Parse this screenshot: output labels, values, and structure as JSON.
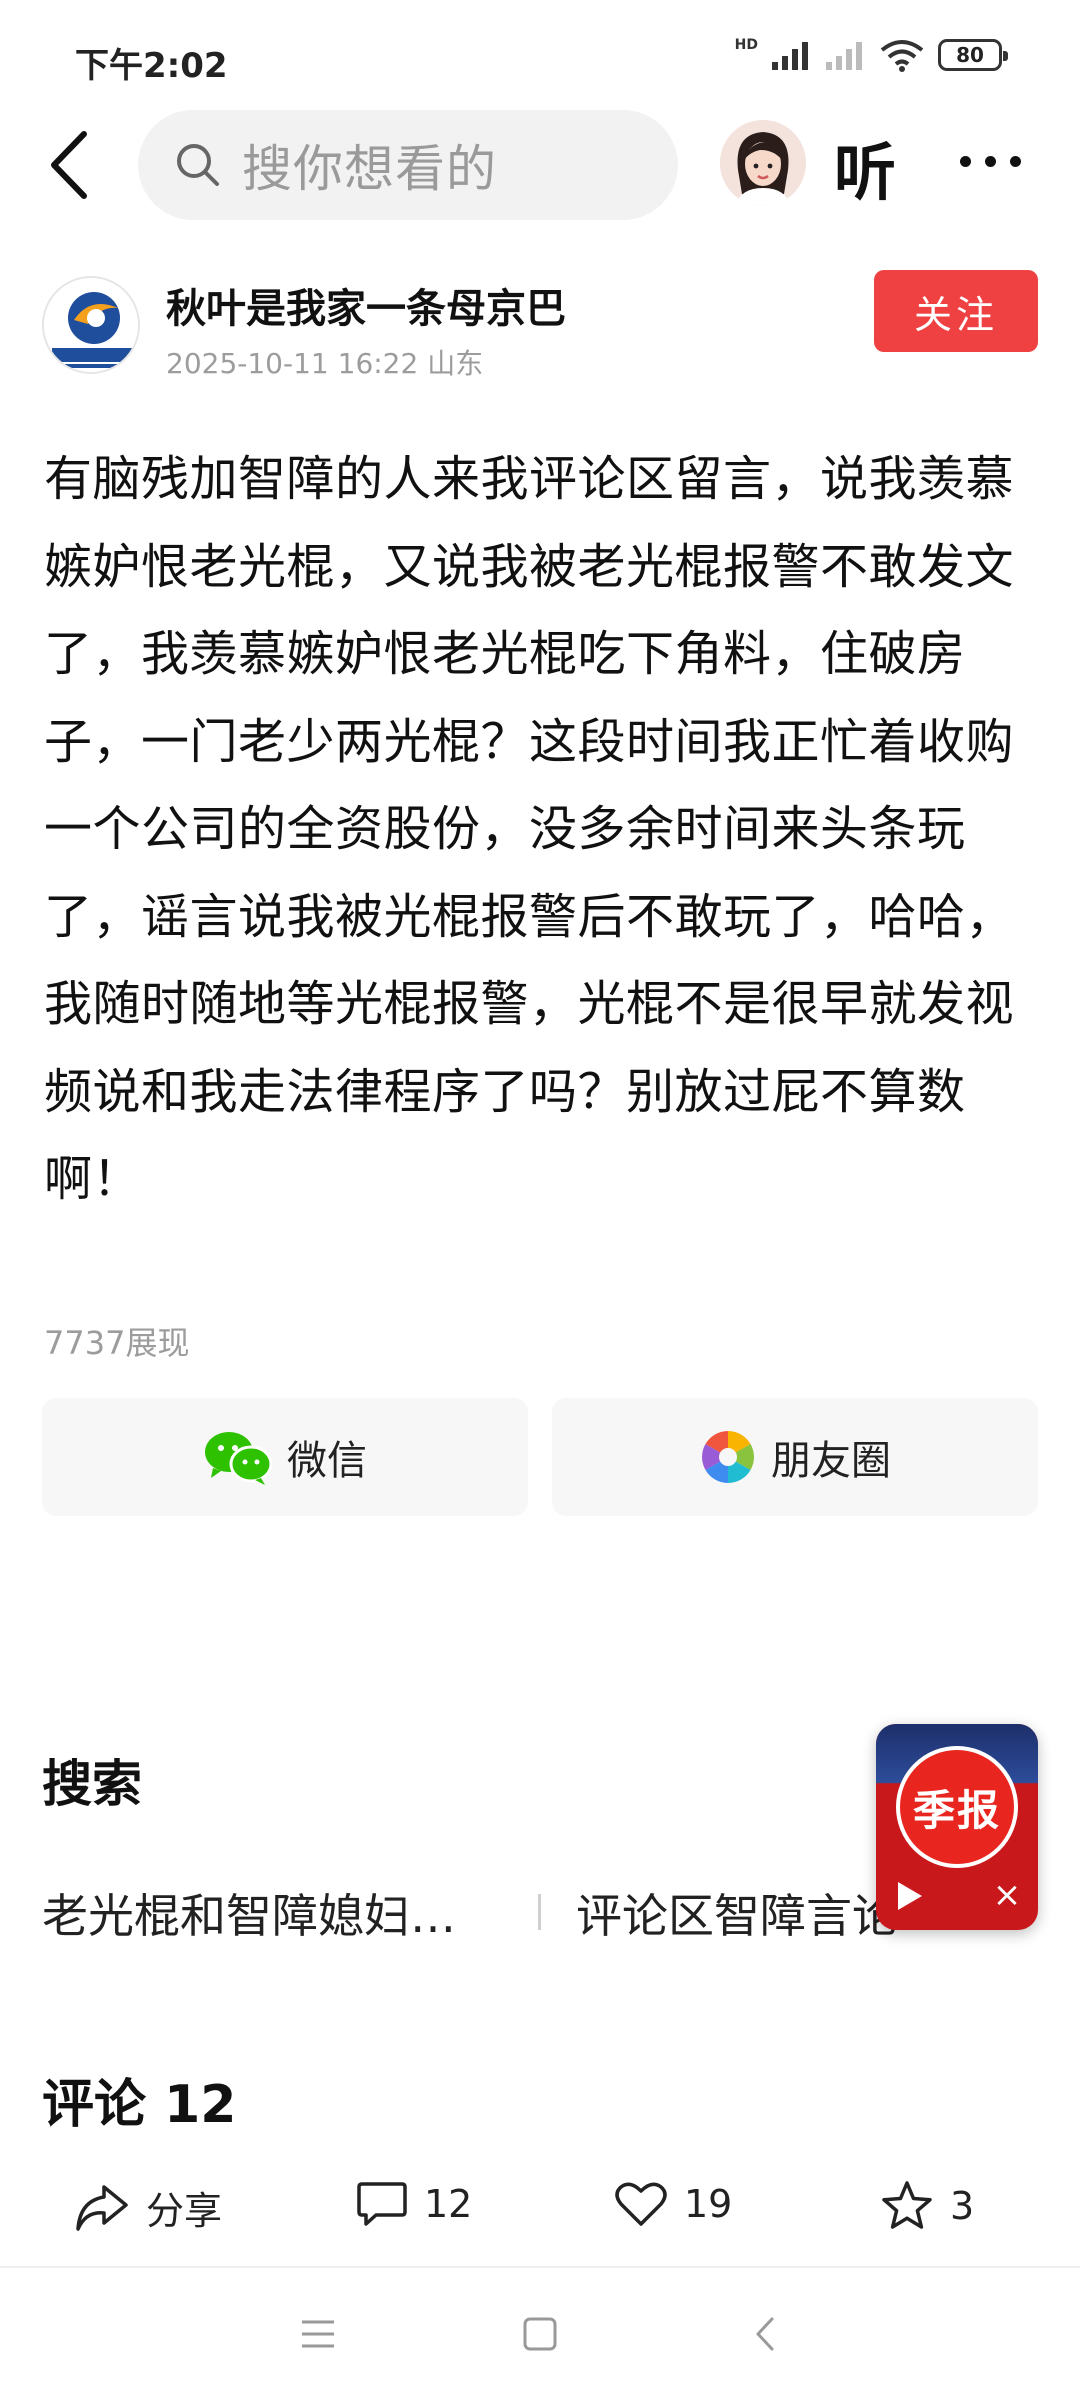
{
  "status_bar": {
    "time": "下午2:02",
    "hd_label": "HD",
    "battery": "80"
  },
  "nav": {
    "search_placeholder": "搜你想看的",
    "listen_label": "听"
  },
  "author": {
    "name": "秋叶是我家一条母京巴",
    "meta": "2025-10-11 16:22 山东",
    "follow_label": "关注"
  },
  "post": {
    "body": "有脑残加智障的人来我评论区留言，说我羡慕嫉妒恨老光棍，又说我被老光棍报警不敢发文了，我羡慕嫉妒恨老光棍吃下角料，住破房子，一门老少两光棍？这段时间我正忙着收购一个公司的全资股份，没多余时间来头条玩了，谣言说我被光棍报警后不敢玩了，哈哈，我随时随地等光棍报警，光棍不是很早就发视频说和我走法律程序了吗？别放过屁不算数啊！",
    "impressions": "7737展现"
  },
  "share": {
    "wechat_label": "微信",
    "moments_label": "朋友圈"
  },
  "search": {
    "heading": "搜索",
    "items": [
      "老光棍和智障媳妇…",
      "评论区智障言论"
    ]
  },
  "promo": {
    "label": "季报",
    "close": "×"
  },
  "comments": {
    "heading": "评论 12"
  },
  "actions": {
    "share_label": "分享",
    "comment_count": "12",
    "like_count": "19",
    "star_count": "3"
  },
  "colors": {
    "accent": "#f04142",
    "wechat_green": "#2dc100",
    "muted_text": "#9c9c9c"
  }
}
